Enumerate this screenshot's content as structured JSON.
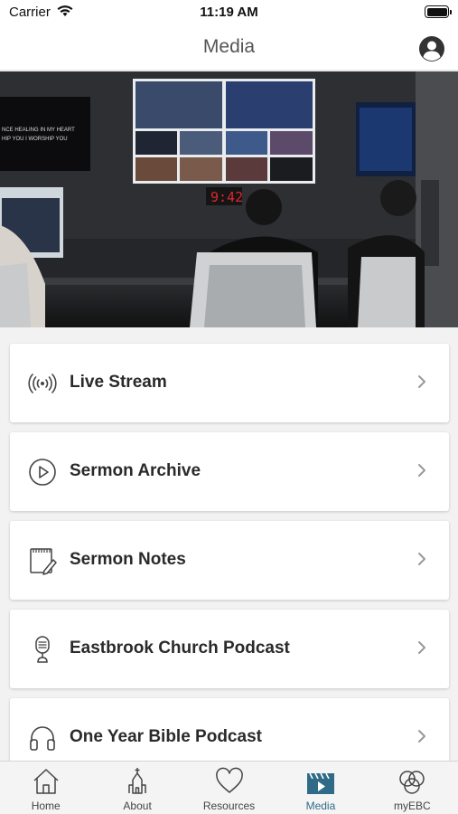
{
  "status_bar": {
    "carrier": "Carrier",
    "time": "11:19 AM",
    "battery_level": 1.0
  },
  "nav": {
    "title": "Media",
    "profile_icon": "user-circle-icon"
  },
  "hero": {
    "screen_text_line1": "NCE HEALING IN MY HEART",
    "screen_text_line2": "HIP YOU I WORSHIP YOU",
    "clock_text": "9:42"
  },
  "menu": [
    {
      "label": "Live Stream",
      "icon": "broadcast-icon"
    },
    {
      "label": "Sermon Archive",
      "icon": "play-circle-icon"
    },
    {
      "label": "Sermon Notes",
      "icon": "notepad-icon"
    },
    {
      "label": "Eastbrook Church Podcast",
      "icon": "microphone-icon"
    },
    {
      "label": "One Year Bible Podcast",
      "icon": "headphones-icon"
    }
  ],
  "tabs": [
    {
      "label": "Home",
      "icon": "home-icon"
    },
    {
      "label": "About",
      "icon": "church-icon"
    },
    {
      "label": "Resources",
      "icon": "heart-icon"
    },
    {
      "label": "Media",
      "icon": "clapperboard-icon",
      "active": true
    },
    {
      "label": "myEBC",
      "icon": "circles-icon"
    }
  ],
  "colors": {
    "active_tab": "#2f6b86",
    "card_bg": "#ffffff",
    "page_bg": "#f2f2f2"
  }
}
